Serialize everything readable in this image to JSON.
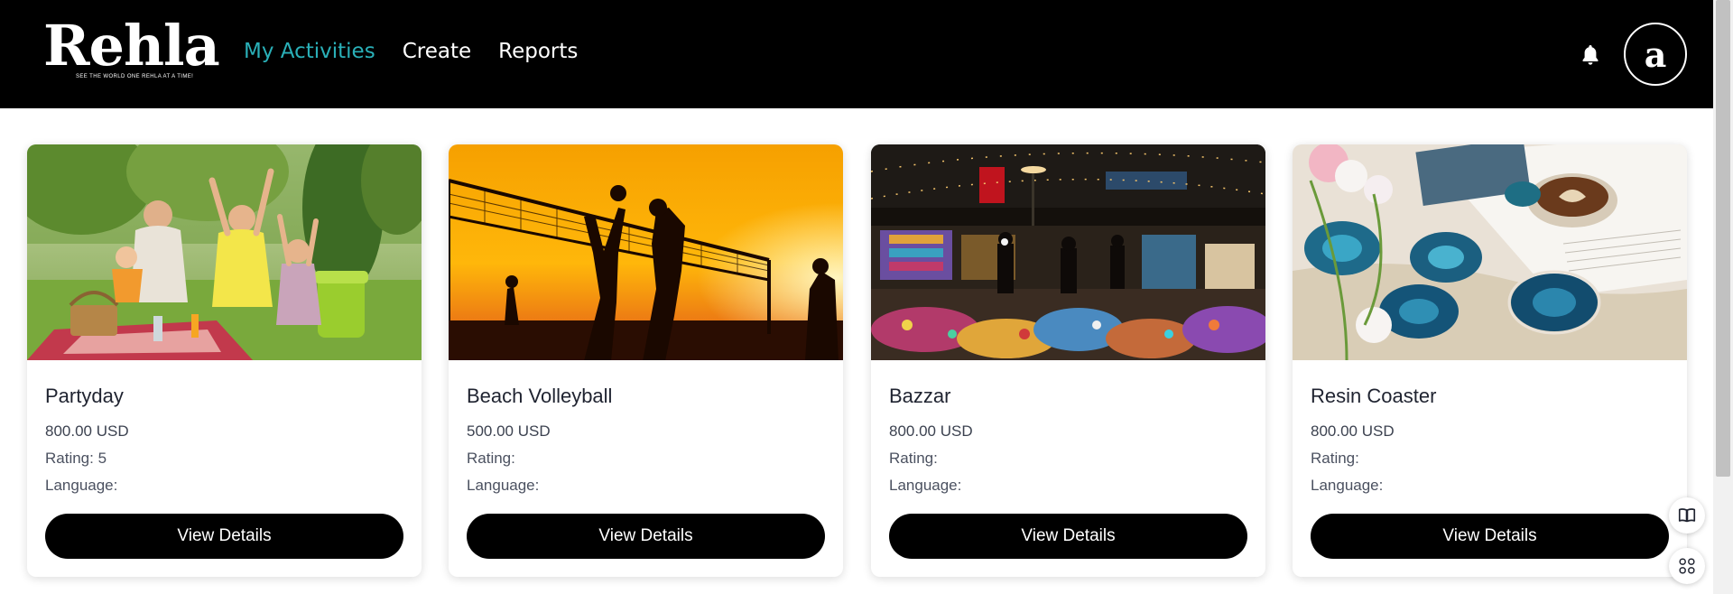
{
  "brand": {
    "name": "Rehla",
    "tagline": "SEE THE WORLD ONE REHLA AT A TIME!"
  },
  "nav": {
    "items": [
      {
        "label": "My Activities",
        "active": true
      },
      {
        "label": "Create",
        "active": false
      },
      {
        "label": "Reports",
        "active": false
      }
    ]
  },
  "header": {
    "notification_icon": "bell-icon",
    "avatar_letter": "a"
  },
  "activities": [
    {
      "title": "Partyday",
      "price": "800.00 USD",
      "rating": "Rating: 5",
      "language": "Language:",
      "button": "View Details",
      "image": "family picnic on grass"
    },
    {
      "title": "Beach Volleyball",
      "price": "500.00 USD",
      "rating": "Rating:",
      "language": "Language:",
      "button": "View Details",
      "image": "volleyball silhouettes at sunset"
    },
    {
      "title": "Bazzar",
      "price": "800.00 USD",
      "rating": "Rating:",
      "language": "Language:",
      "button": "View Details",
      "image": "night market stalls"
    },
    {
      "title": "Resin Coaster",
      "price": "800.00 USD",
      "rating": "Rating:",
      "language": "Language:",
      "button": "View Details",
      "image": "blue resin coasters with coffee"
    }
  ],
  "floating": {
    "book_icon": "book-icon",
    "apps_icon": "apps-icon"
  },
  "colors": {
    "header_bg": "#000000",
    "nav_active": "#2ab0b8",
    "button_bg": "#000000"
  }
}
